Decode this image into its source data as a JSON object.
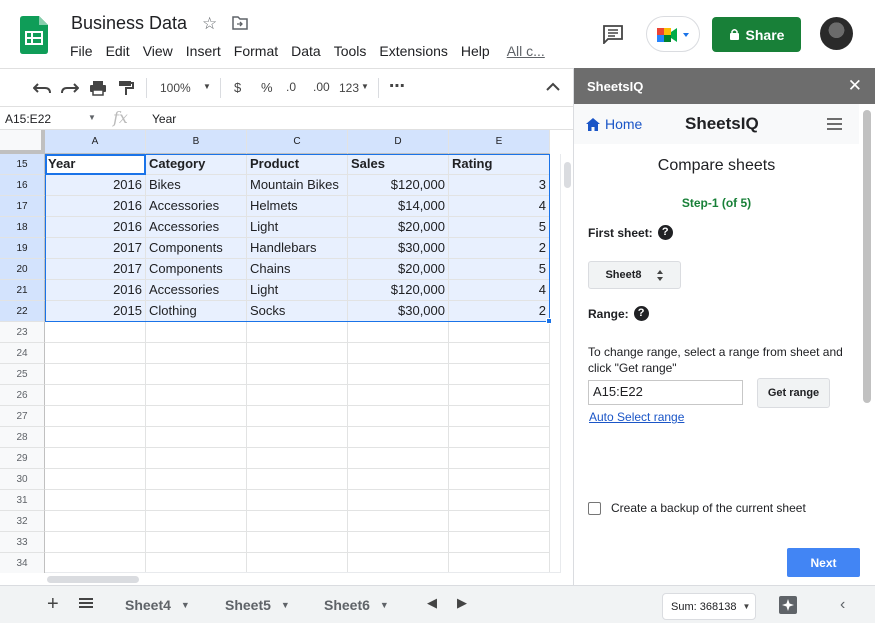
{
  "app": {
    "doc_title": "Business Data",
    "menu": [
      "File",
      "Edit",
      "View",
      "Insert",
      "Format",
      "Data",
      "Tools",
      "Extensions",
      "Help"
    ],
    "last_edit": "All c...",
    "share_label": "Share",
    "colors": {
      "share_green": "#188038",
      "selection_blue": "#1a73e8",
      "panel_header": "#6d6d6d",
      "next_blue": "#4285f4",
      "step_green": "#188038"
    }
  },
  "toolbar": {
    "zoom": "100%",
    "currency": "$",
    "percent": "%",
    "decrease_decimal": ".0",
    "increase_decimal": ".00",
    "number_format": "123"
  },
  "formula_bar": {
    "name_box": "A15:E22",
    "fx": "fx",
    "value": "Year"
  },
  "grid": {
    "columns": [
      "A",
      "B",
      "C",
      "D",
      "E"
    ],
    "rows": [
      {
        "num": "15",
        "cells": [
          "Year",
          "Category",
          "Product",
          "Sales",
          "Rating"
        ]
      },
      {
        "num": "16",
        "cells": [
          "2016",
          "Bikes",
          "Mountain Bikes",
          "$120,000",
          "3"
        ]
      },
      {
        "num": "17",
        "cells": [
          "2016",
          "Accessories",
          "Helmets",
          "$14,000",
          "4"
        ]
      },
      {
        "num": "18",
        "cells": [
          "2016",
          "Accessories",
          "Light",
          "$20,000",
          "5"
        ]
      },
      {
        "num": "19",
        "cells": [
          "2017",
          "Components",
          "Handlebars",
          "$30,000",
          "2"
        ]
      },
      {
        "num": "20",
        "cells": [
          "2017",
          "Components",
          "Chains",
          "$20,000",
          "5"
        ]
      },
      {
        "num": "21",
        "cells": [
          "2016",
          "Accessories",
          "Light",
          "$120,000",
          "4"
        ]
      },
      {
        "num": "22",
        "cells": [
          "2015",
          "Clothing",
          "Socks",
          "$30,000",
          "2"
        ]
      },
      {
        "num": "23",
        "cells": [
          "",
          "",
          "",
          "",
          ""
        ]
      },
      {
        "num": "24",
        "cells": [
          "",
          "",
          "",
          "",
          ""
        ]
      },
      {
        "num": "25",
        "cells": [
          "",
          "",
          "",
          "",
          ""
        ]
      },
      {
        "num": "26",
        "cells": [
          "",
          "",
          "",
          "",
          ""
        ]
      },
      {
        "num": "27",
        "cells": [
          "",
          "",
          "",
          "",
          ""
        ]
      },
      {
        "num": "28",
        "cells": [
          "",
          "",
          "",
          "",
          ""
        ]
      },
      {
        "num": "29",
        "cells": [
          "",
          "",
          "",
          "",
          ""
        ]
      },
      {
        "num": "30",
        "cells": [
          "",
          "",
          "",
          "",
          ""
        ]
      },
      {
        "num": "31",
        "cells": [
          "",
          "",
          "",
          "",
          ""
        ]
      },
      {
        "num": "32",
        "cells": [
          "",
          "",
          "",
          "",
          ""
        ]
      },
      {
        "num": "33",
        "cells": [
          "",
          "",
          "",
          "",
          ""
        ]
      },
      {
        "num": "34",
        "cells": [
          "",
          "",
          "",
          "",
          ""
        ]
      }
    ]
  },
  "sheets": {
    "tabs": [
      "Sheet4",
      "Sheet5",
      "Sheet6"
    ],
    "sum_label": "Sum: 368138"
  },
  "panel": {
    "header_title": "SheetsIQ",
    "home_label": "Home",
    "brand": "SheetsIQ",
    "compare_title": "Compare sheets",
    "step": "Step-1 (of 5)",
    "first_sheet_label": "First sheet:",
    "sheet_selected": "Sheet8",
    "range_label": "Range:",
    "range_help": "To change range, select a range from sheet and click \"Get range\"",
    "range_value": "A15:E22",
    "get_range_label": "Get range",
    "auto_select_label": "Auto Select range",
    "backup_label": "Create a backup of the current sheet",
    "backup_checked": false,
    "next_label": "Next"
  }
}
